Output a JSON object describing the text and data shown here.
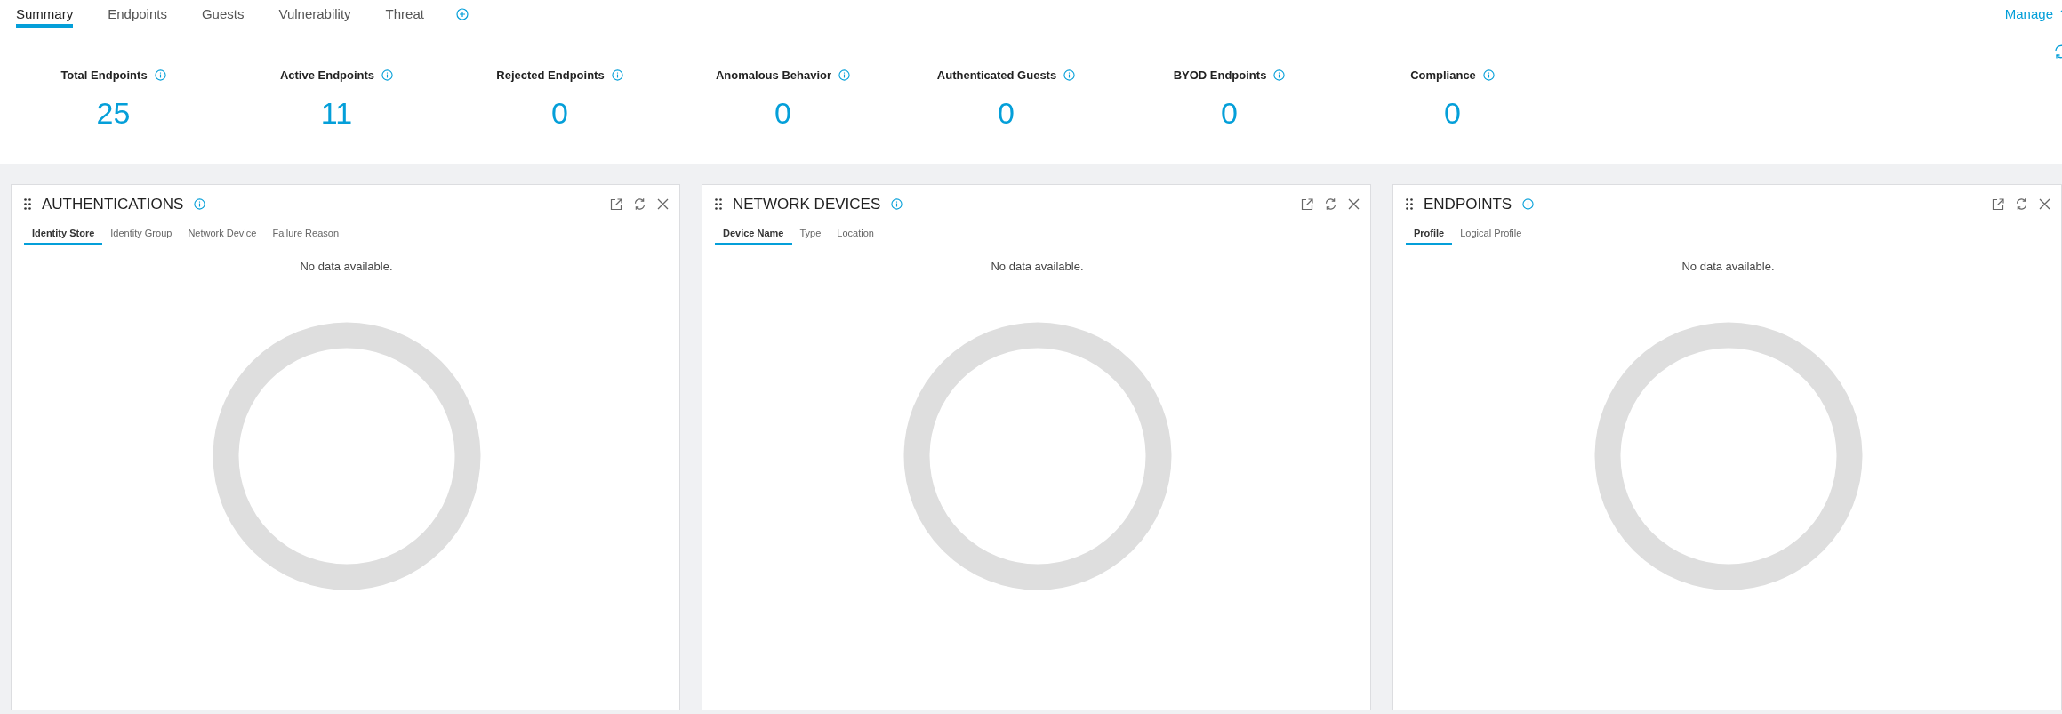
{
  "top_tabs": [
    {
      "label": "Summary",
      "selected": true
    },
    {
      "label": "Endpoints",
      "selected": false
    },
    {
      "label": "Guests",
      "selected": false
    },
    {
      "label": "Vulnerability",
      "selected": false
    },
    {
      "label": "Threat",
      "selected": false
    }
  ],
  "manage": {
    "label": "Manage"
  },
  "metrics": [
    {
      "label": "Total Endpoints",
      "value": "25"
    },
    {
      "label": "Active Endpoints",
      "value": "11"
    },
    {
      "label": "Rejected Endpoints",
      "value": "0"
    },
    {
      "label": "Anomalous Behavior",
      "value": "0"
    },
    {
      "label": "Authenticated Guests",
      "value": "0"
    },
    {
      "label": "BYOD Endpoints",
      "value": "0"
    },
    {
      "label": "Compliance",
      "value": "0"
    }
  ],
  "panels": [
    {
      "title": "AUTHENTICATIONS",
      "tabs": [
        {
          "label": "Identity Store",
          "selected": true
        },
        {
          "label": "Identity Group",
          "selected": false
        },
        {
          "label": "Network Device",
          "selected": false
        },
        {
          "label": "Failure Reason",
          "selected": false
        }
      ],
      "message": "No data available."
    },
    {
      "title": "NETWORK DEVICES",
      "tabs": [
        {
          "label": "Device Name",
          "selected": true
        },
        {
          "label": "Type",
          "selected": false
        },
        {
          "label": "Location",
          "selected": false
        }
      ],
      "message": "No data available."
    },
    {
      "title": "ENDPOINTS",
      "tabs": [
        {
          "label": "Profile",
          "selected": true
        },
        {
          "label": "Logical Profile",
          "selected": false
        }
      ],
      "message": "No data available."
    }
  ]
}
